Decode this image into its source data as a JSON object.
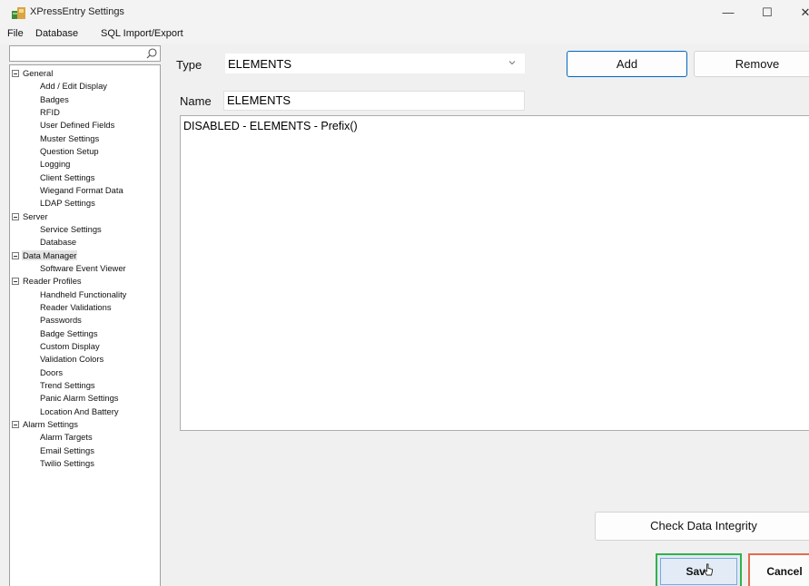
{
  "window": {
    "title": "XPressEntry Settings",
    "minimize_glyph": "—",
    "maximize_glyph": "☐",
    "close_glyph": "✕"
  },
  "menu": [
    "File",
    "Database",
    "SQL Import/Export"
  ],
  "tree": [
    {
      "label": "General",
      "level": 0
    },
    {
      "label": "Add / Edit Display",
      "level": 1
    },
    {
      "label": "Badges",
      "level": 1
    },
    {
      "label": "RFID",
      "level": 1
    },
    {
      "label": "User Defined Fields",
      "level": 1
    },
    {
      "label": "Muster Settings",
      "level": 1
    },
    {
      "label": "Question Setup",
      "level": 1
    },
    {
      "label": "Logging",
      "level": 1
    },
    {
      "label": "Client Settings",
      "level": 1
    },
    {
      "label": "Wiegand Format Data",
      "level": 1
    },
    {
      "label": "LDAP Settings",
      "level": 1
    },
    {
      "label": "Server",
      "level": 0
    },
    {
      "label": "Service Settings",
      "level": 1
    },
    {
      "label": "Database",
      "level": 1
    },
    {
      "label": "Data Manager",
      "level": 0,
      "selected": true
    },
    {
      "label": "Software Event Viewer",
      "level": 1
    },
    {
      "label": "Reader Profiles",
      "level": 0
    },
    {
      "label": "Handheld Functionality",
      "level": 1
    },
    {
      "label": "Reader Validations",
      "level": 1
    },
    {
      "label": "Passwords",
      "level": 1
    },
    {
      "label": "Badge Settings",
      "level": 1
    },
    {
      "label": "Custom Display",
      "level": 1
    },
    {
      "label": "Validation Colors",
      "level": 1
    },
    {
      "label": "Doors",
      "level": 1
    },
    {
      "label": "Trend Settings",
      "level": 1
    },
    {
      "label": "Panic Alarm Settings",
      "level": 1
    },
    {
      "label": "Location And Battery",
      "level": 1
    },
    {
      "label": "Alarm Settings",
      "level": 0
    },
    {
      "label": "Alarm Targets",
      "level": 1
    },
    {
      "label": "Email Settings",
      "level": 1
    },
    {
      "label": "Twilio Settings",
      "level": 1
    }
  ],
  "main": {
    "type_label": "Type",
    "type_value": "ELEMENTS",
    "name_label": "Name",
    "name_value": "ELEMENTS",
    "content_text": "DISABLED - ELEMENTS - Prefix()",
    "add_label": "Add",
    "remove_label": "Remove",
    "check_label": "Check Data Integrity",
    "save_label": "Save",
    "cancel_label": "Cancel"
  },
  "colors": {
    "accent": "#0067c0",
    "save_highlight": "#2fb34b",
    "cancel_highlight": "#e46a4d"
  }
}
